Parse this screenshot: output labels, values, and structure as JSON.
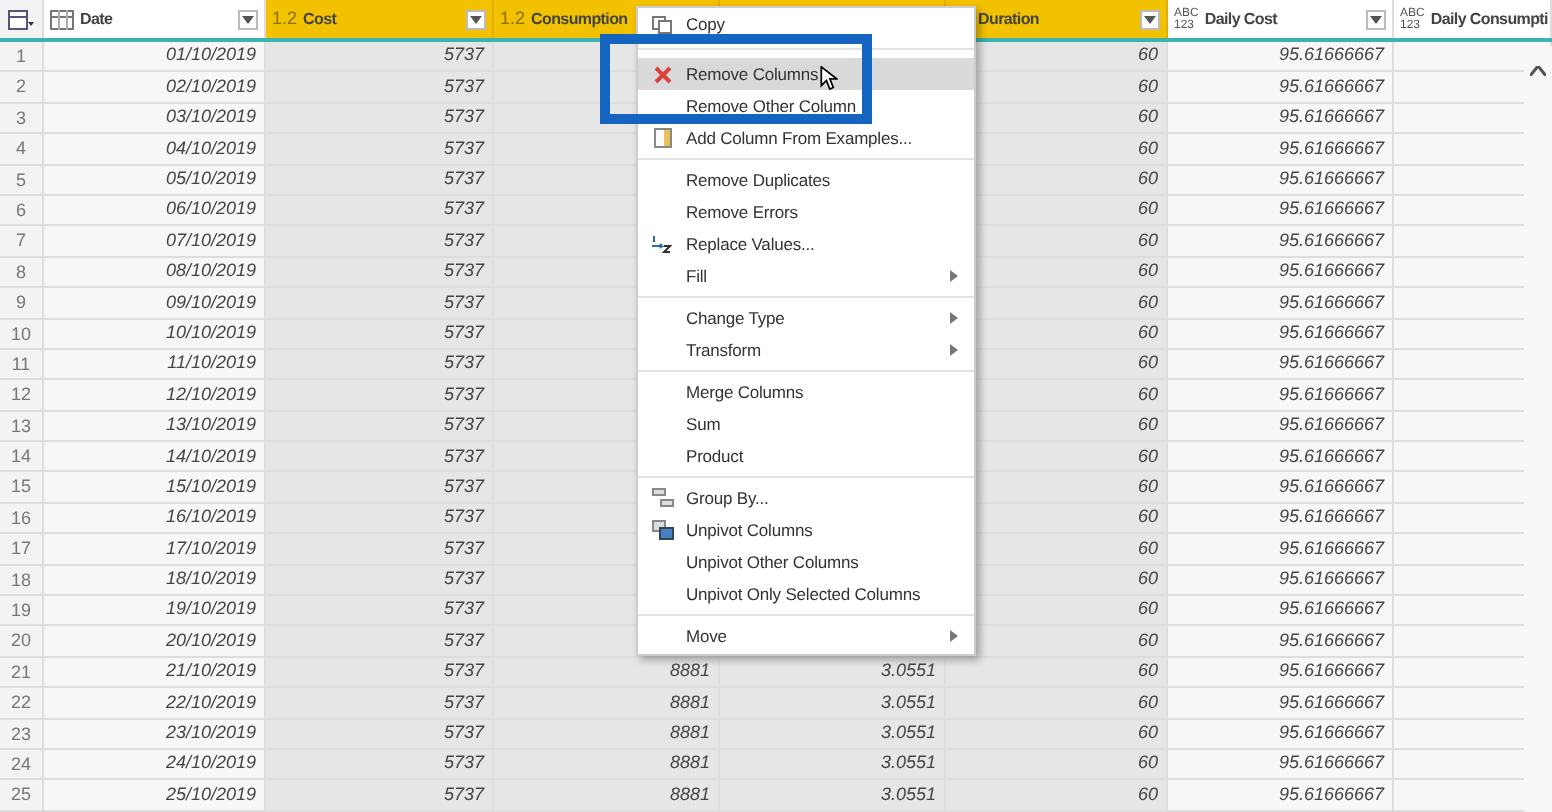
{
  "table": {
    "columns": [
      {
        "name": "Date",
        "kind": "date",
        "selected": false
      },
      {
        "name": "Cost",
        "kind": "decimal",
        "type": "1.2",
        "selected": true
      },
      {
        "name": "Consumption",
        "kind": "decimal",
        "type": "1.2",
        "selected": true
      },
      {
        "kind": "covered",
        "selected": true
      },
      {
        "name": "Duration",
        "kind": "covered",
        "selected": true
      },
      {
        "name": "Daily Cost",
        "kind": "any",
        "type": "ABC\n123",
        "selected": false
      },
      {
        "name": "Daily Consumpti",
        "kind": "any",
        "type": "ABC\n123",
        "selected": false
      }
    ],
    "rows": [
      {
        "n": "1",
        "cells": [
          "01/10/2019",
          "5737",
          null,
          null,
          "60",
          "95.61666667",
          null
        ]
      },
      {
        "n": "2",
        "cells": [
          "02/10/2019",
          "5737",
          null,
          null,
          "60",
          "95.61666667",
          null
        ]
      },
      {
        "n": "3",
        "cells": [
          "03/10/2019",
          "5737",
          null,
          null,
          "60",
          "95.61666667",
          null
        ]
      },
      {
        "n": "4",
        "cells": [
          "04/10/2019",
          "5737",
          null,
          null,
          "60",
          "95.61666667",
          null
        ]
      },
      {
        "n": "5",
        "cells": [
          "05/10/2019",
          "5737",
          null,
          null,
          "60",
          "95.61666667",
          null
        ]
      },
      {
        "n": "6",
        "cells": [
          "06/10/2019",
          "5737",
          null,
          null,
          "60",
          "95.61666667",
          null
        ]
      },
      {
        "n": "7",
        "cells": [
          "07/10/2019",
          "5737",
          null,
          null,
          "60",
          "95.61666667",
          null
        ]
      },
      {
        "n": "8",
        "cells": [
          "08/10/2019",
          "5737",
          null,
          null,
          "60",
          "95.61666667",
          null
        ]
      },
      {
        "n": "9",
        "cells": [
          "09/10/2019",
          "5737",
          null,
          null,
          "60",
          "95.61666667",
          null
        ]
      },
      {
        "n": "10",
        "cells": [
          "10/10/2019",
          "5737",
          null,
          null,
          "60",
          "95.61666667",
          null
        ]
      },
      {
        "n": "11",
        "cells": [
          "11/10/2019",
          "5737",
          null,
          null,
          "60",
          "95.61666667",
          null
        ]
      },
      {
        "n": "12",
        "cells": [
          "12/10/2019",
          "5737",
          null,
          null,
          "60",
          "95.61666667",
          null
        ]
      },
      {
        "n": "13",
        "cells": [
          "13/10/2019",
          "5737",
          null,
          null,
          "60",
          "95.61666667",
          null
        ]
      },
      {
        "n": "14",
        "cells": [
          "14/10/2019",
          "5737",
          null,
          null,
          "60",
          "95.61666667",
          null
        ]
      },
      {
        "n": "15",
        "cells": [
          "15/10/2019",
          "5737",
          null,
          null,
          "60",
          "95.61666667",
          null
        ]
      },
      {
        "n": "16",
        "cells": [
          "16/10/2019",
          "5737",
          null,
          null,
          "60",
          "95.61666667",
          null
        ]
      },
      {
        "n": "17",
        "cells": [
          "17/10/2019",
          "5737",
          null,
          null,
          "60",
          "95.61666667",
          null
        ]
      },
      {
        "n": "18",
        "cells": [
          "18/10/2019",
          "5737",
          null,
          null,
          "60",
          "95.61666667",
          null
        ]
      },
      {
        "n": "19",
        "cells": [
          "19/10/2019",
          "5737",
          null,
          null,
          "60",
          "95.61666667",
          null
        ]
      },
      {
        "n": "20",
        "cells": [
          "20/10/2019",
          "5737",
          null,
          null,
          "60",
          "95.61666667",
          null
        ]
      },
      {
        "n": "21",
        "cells": [
          "21/10/2019",
          "5737",
          "8881",
          "3.0551",
          "60",
          "95.61666667",
          null
        ]
      },
      {
        "n": "22",
        "cells": [
          "22/10/2019",
          "5737",
          "8881",
          "3.0551",
          "60",
          "95.61666667",
          null
        ]
      },
      {
        "n": "23",
        "cells": [
          "23/10/2019",
          "5737",
          "8881",
          "3.0551",
          "60",
          "95.61666667",
          null
        ]
      },
      {
        "n": "24",
        "cells": [
          "24/10/2019",
          "5737",
          "8881",
          "3.0551",
          "60",
          "95.61666667",
          null
        ]
      },
      {
        "n": "25",
        "cells": [
          "25/10/2019",
          "5737",
          "8881",
          "3.0551",
          "60",
          "95.61666667",
          null
        ]
      }
    ]
  },
  "context_menu": {
    "groups": [
      [
        {
          "label": "Copy",
          "kind": "plain",
          "selected": false
        }
      ],
      [
        {
          "label": "Remove Columns",
          "kind": "plain",
          "selected": true
        },
        {
          "label": "Remove Other Column",
          "kind": "plain",
          "selected": false
        },
        {
          "label": "Add Column From Examples...",
          "kind": "plain",
          "selected": false
        }
      ],
      [
        {
          "label": "Remove Duplicates",
          "kind": "plain",
          "selected": false
        },
        {
          "label": "Remove Errors",
          "kind": "plain",
          "selected": false
        },
        {
          "label": "Replace Values...",
          "kind": "plain",
          "selected": false
        },
        {
          "label": "Fill",
          "kind": "submenu",
          "selected": false
        }
      ],
      [
        {
          "label": "Change Type",
          "kind": "submenu",
          "selected": false
        },
        {
          "label": "Transform",
          "kind": "submenu",
          "selected": false
        }
      ],
      [
        {
          "label": "Merge Columns",
          "kind": "plain",
          "selected": false
        },
        {
          "label": "Sum",
          "kind": "plain",
          "selected": false
        },
        {
          "label": "Product",
          "kind": "plain",
          "selected": false
        }
      ],
      [
        {
          "label": "Group By...",
          "kind": "plain",
          "selected": false
        },
        {
          "label": "Unpivot Columns",
          "kind": "plain",
          "selected": false
        },
        {
          "label": "Unpivot Other Columns",
          "kind": "plain",
          "selected": false
        },
        {
          "label": "Unpivot Only Selected Columns",
          "kind": "plain",
          "selected": false
        }
      ],
      [
        {
          "label": "Move",
          "kind": "submenu",
          "selected": false
        }
      ]
    ]
  }
}
